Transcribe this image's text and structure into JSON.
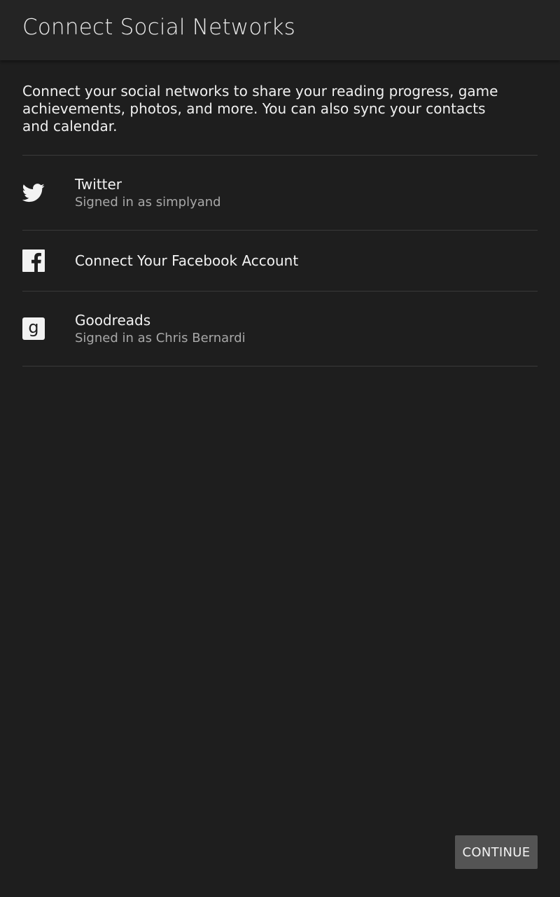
{
  "header": {
    "title": "Connect Social Networks"
  },
  "intro": {
    "text": "Connect your social networks to share your reading progress, game achievements, photos, and more. You can also sync your contacts and calendar."
  },
  "networks": [
    {
      "icon": "twitter-icon",
      "title": "Twitter",
      "subtitle": "Signed in as simplyand"
    },
    {
      "icon": "facebook-icon",
      "title": "Connect Your Facebook Account",
      "subtitle": ""
    },
    {
      "icon": "goodreads-icon",
      "title": "Goodreads",
      "subtitle": "Signed in as Chris Bernardi"
    }
  ],
  "footer": {
    "continue_label": "CONTINUE"
  },
  "colors": {
    "background": "#1e1e1e",
    "header": "#242424",
    "button": "#545454",
    "secondary_text": "#a8a8a8"
  }
}
